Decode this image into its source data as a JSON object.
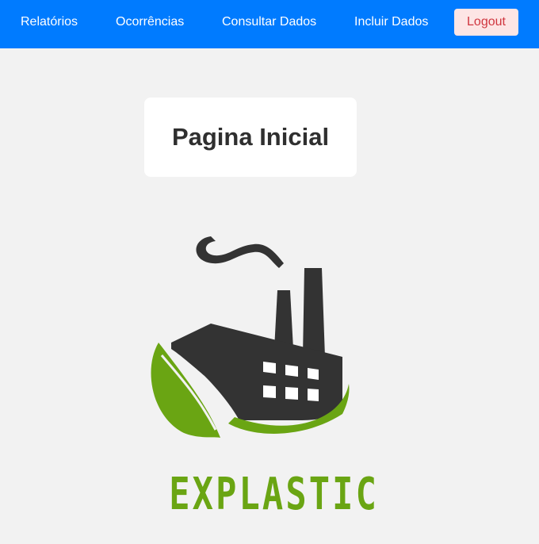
{
  "nav": {
    "items": [
      {
        "label": "Relatórios"
      },
      {
        "label": "Ocorrências"
      },
      {
        "label": "Consultar Dados"
      },
      {
        "label": "Incluir Dados"
      }
    ],
    "logout_label": "Logout"
  },
  "main": {
    "title": "Pagina Inicial"
  },
  "logo": {
    "text": "EXPLASTIC",
    "icon": "factory-leaf-icon",
    "colors": {
      "dark": "#333333",
      "green": "#6aa513"
    }
  },
  "colors": {
    "navbar": "#007bff",
    "background": "#f2f2f2",
    "logout_bg": "#fde5e5",
    "logout_text": "#d0363f"
  }
}
